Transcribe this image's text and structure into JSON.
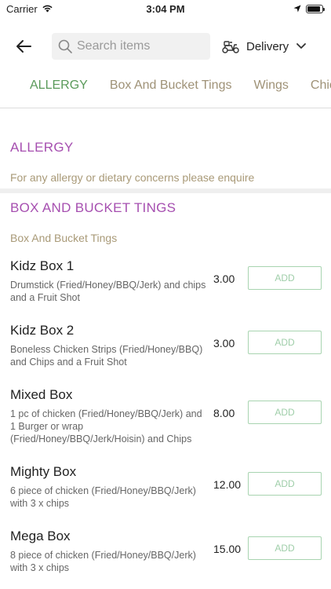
{
  "status": {
    "carrier": "Carrier",
    "time": "3:04 PM",
    "battery_level": 0.9
  },
  "header": {
    "search_placeholder": "Search items",
    "delivery_label": "Delivery"
  },
  "tabs": [
    {
      "label": "ALLERGY",
      "active": true
    },
    {
      "label": "Box And Bucket Tings",
      "active": false
    },
    {
      "label": "Wings",
      "active": false
    },
    {
      "label": "Chicken",
      "active": false
    }
  ],
  "sections": {
    "allergy": {
      "title": "ALLERGY",
      "subtitle": "For any allergy or dietary concerns please enquire"
    },
    "box": {
      "title": "BOX AND BUCKET TINGS",
      "subtitle": "Box And Bucket Tings",
      "items": [
        {
          "name": "Kidz Box 1",
          "desc": "Drumstick (Fried/Honey/BBQ/Jerk) and chips and a Fruit Shot",
          "price": "3.00",
          "add": "ADD"
        },
        {
          "name": "Kidz Box 2",
          "desc": "Boneless Chicken Strips (Fried/Honey/BBQ) and Chips and a Fruit Shot",
          "price": "3.00",
          "add": "ADD"
        },
        {
          "name": "Mixed Box",
          "desc": "1 pc of chicken (Fried/Honey/BBQ/Jerk) and 1 Burger or wrap (Fried/Honey/BBQ/Jerk/Hoisin) and Chips",
          "price": "8.00",
          "add": "ADD"
        },
        {
          "name": "Mighty Box",
          "desc": "6 piece of chicken (Fried/Honey/BBQ/Jerk) with 3 x chips",
          "price": "12.00",
          "add": "ADD"
        },
        {
          "name": "Mega Box",
          "desc": "8 piece of chicken (Fried/Honey/BBQ/Jerk) with 3 x chips",
          "price": "15.00",
          "add": "ADD"
        }
      ]
    }
  },
  "colors": {
    "accent_green": "#5a9a5a",
    "section_purple": "#a64fb0",
    "subtitle_tan": "#a99a78",
    "add_border": "#a8d4b0"
  },
  "icons": [
    "wifi-icon",
    "location-arrow-icon",
    "battery-icon",
    "back-arrow-icon",
    "search-icon",
    "scooter-icon",
    "chevron-down-icon"
  ]
}
